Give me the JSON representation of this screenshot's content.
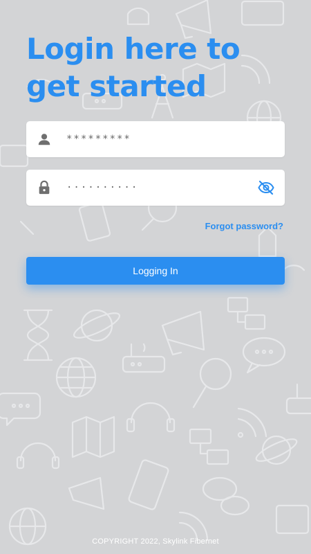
{
  "title": "Login here to get started",
  "username": {
    "value": "*********",
    "icon": "person-icon"
  },
  "password": {
    "value": "··········",
    "icon": "lock-icon",
    "toggle_icon": "eye-off-icon"
  },
  "forgot_link": "Forgot password?",
  "login_button": "Logging In",
  "footer": "COPYRIGHT 2022, Skylink Fibernet",
  "colors": {
    "accent": "#2b8ef0",
    "background": "#d3d4d6",
    "icon": "#6f6f6f"
  }
}
